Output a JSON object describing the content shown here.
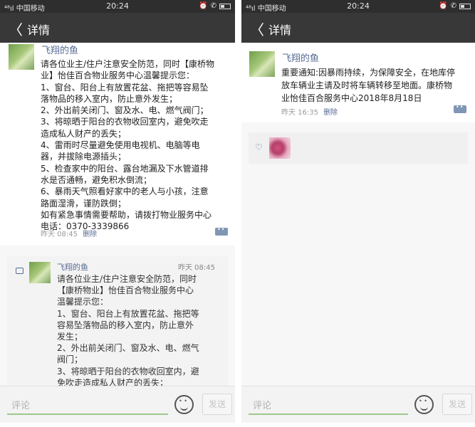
{
  "status": {
    "left": {
      "carrier": "中国移动",
      "time": "20:24",
      "signal": "⁴⁸ıl"
    },
    "right": {
      "carrier": "中国移动",
      "time": "20:24",
      "signal": "⁴⁸ıl"
    }
  },
  "nav": {
    "back_icon": "chevron-left-icon",
    "title": "详情"
  },
  "left_post": {
    "author": "飞翔的鱼",
    "lines": [
      "请各位业主/住户注意安全防范，同时【康桥物",
      "业】怡佳百合物业服务中心温馨提示您：",
      "1、窗台、阳台上有放置花盆、拖把等容易坠",
      "落物品的移入室内，防止意外发生；",
      "2、外出前关闭门、窗及水、电、燃气阀门；",
      "3、将晾晒于阳台的衣物收回室内，避免吹走",
      "造成私人财产的丢失；",
      "4、雷雨时尽量避免使用电视机、电脑等电",
      "器，并拔除电源插头；",
      "5、检查家中的阳台、露台地漏及下水管道排",
      "水是否通畅，避免积水倒流；",
      "6、暴雨天气照看好家中的老人与小孩，注意",
      "路面湿滑，谨防跌倒；",
      "如有紧急事情需要帮助，请拨打物业服务中心",
      "电话：0370-3339866"
    ],
    "time": "昨天 08:45",
    "delete": "删除"
  },
  "left_comment": {
    "author": "飞翔的鱼",
    "time": "昨天 08:45",
    "lines": [
      "请各位业主/住户注意安全防范，同时",
      "【康桥物业】怡佳百合物业服务中心",
      "温馨提示您：",
      "1、窗台、阳台上有放置花盆、拖把等",
      "容易坠落物品的移入室内，防止意外",
      "发生；",
      "2、外出前关闭门、窗及水、电、燃气",
      "阀门；",
      "3、将晾晒于阳台的衣物收回室内，避",
      "免吹走造成私人财产的丢失；"
    ]
  },
  "right_post": {
    "author": "飞翔的鱼",
    "lines": [
      "重要通知:因暴雨持续，为保障安全，在地库停",
      "放车辆业主请及时将车辆转移至地面。康桥物",
      "业怡佳百合服务中心2018年8月18日"
    ],
    "time": "昨天 16:35",
    "delete": "删除"
  },
  "input": {
    "placeholder": "评论",
    "send_label": "发送"
  },
  "colors": {
    "link": "#576b95",
    "title_bar": "#383838",
    "status_bar": "#2e2e2e"
  }
}
